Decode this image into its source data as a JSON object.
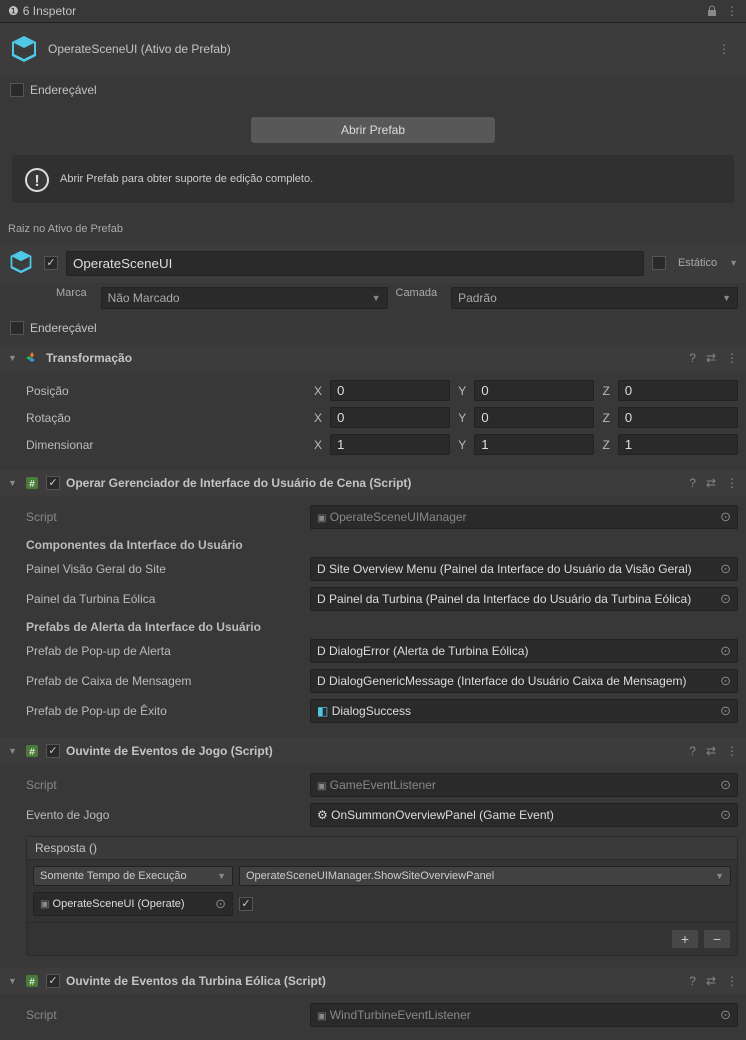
{
  "tab": {
    "title": "6 Inspetor"
  },
  "prefab_header": {
    "name": "OperateSceneUI (Ativo de Prefab)"
  },
  "addressable_label": "Endereçável",
  "open_prefab_btn": "Abrir Prefab",
  "info_banner": "Abrir Prefab para obter suporte de edição completo.",
  "root_label": "Raiz no Ativo de Prefab",
  "object": {
    "name": "OperateSceneUI",
    "static_label": "Estático",
    "tag_label": "Marca",
    "tag_value": "Não Marcado",
    "layer_label": "Camada",
    "layer_value": "Padrão",
    "addressable_label": "Endereçável"
  },
  "transform": {
    "title": "Transformação",
    "position_label": "Posição",
    "rotation_label": "Rotação",
    "scale_label": "Dimensionar",
    "px": "0",
    "py": "0",
    "pz": "0",
    "rx": "0",
    "ry": "0",
    "rz": "0",
    "sx": "1",
    "sy": "1",
    "sz": "1"
  },
  "script1": {
    "title": "Operar Gerenciador de Interface do Usuário de Cena (Script)",
    "script_label": "Script",
    "script_value": "OperateSceneUIManager",
    "section_ui": "Componentes da Interface do Usuário",
    "site_panel_label": "Painel Visão Geral do Site",
    "site_panel_value": "Site Overview Menu (Painel da Interface do Usuário da Visão Geral)",
    "turbine_panel_label": "Painel da Turbina Eólica",
    "turbine_panel_value": "Painel da Turbina (Painel da Interface do Usuário da Turbina Eólica)",
    "section_alerts": "Prefabs de Alerta da Interface do Usuário",
    "alert_popup_label": "Prefab de Pop-up de Alerta",
    "alert_popup_value": "DialogError (Alerta de Turbina Eólica)",
    "msgbox_label": "Prefab de Caixa de Mensagem",
    "msgbox_value": "DialogGenericMessage (Interface do Usuário Caixa de Mensagem)",
    "success_label": "Prefab de Pop-up de Êxito",
    "success_value": "DialogSuccess"
  },
  "listener1": {
    "title": "Ouvinte de Eventos de Jogo (Script)",
    "script_label": "Script",
    "script_value": "GameEventListener",
    "event_label": "Evento de Jogo",
    "event_value": "OnSummonOverviewPanel (Game Event)",
    "response_header": "Resposta ()",
    "runtime_mode": "Somente Tempo de Execução",
    "callback": "OperateSceneUIManager.ShowSiteOverviewPanel",
    "target": "OperateSceneUI (Operate)"
  },
  "listener2": {
    "title": "Ouvinte de Eventos da Turbina Eólica (Script)",
    "script_label": "Script",
    "script_value": "WindTurbineEventListener"
  },
  "axis": {
    "x": "X",
    "y": "Y",
    "z": "Z"
  },
  "prefix_d": "D"
}
